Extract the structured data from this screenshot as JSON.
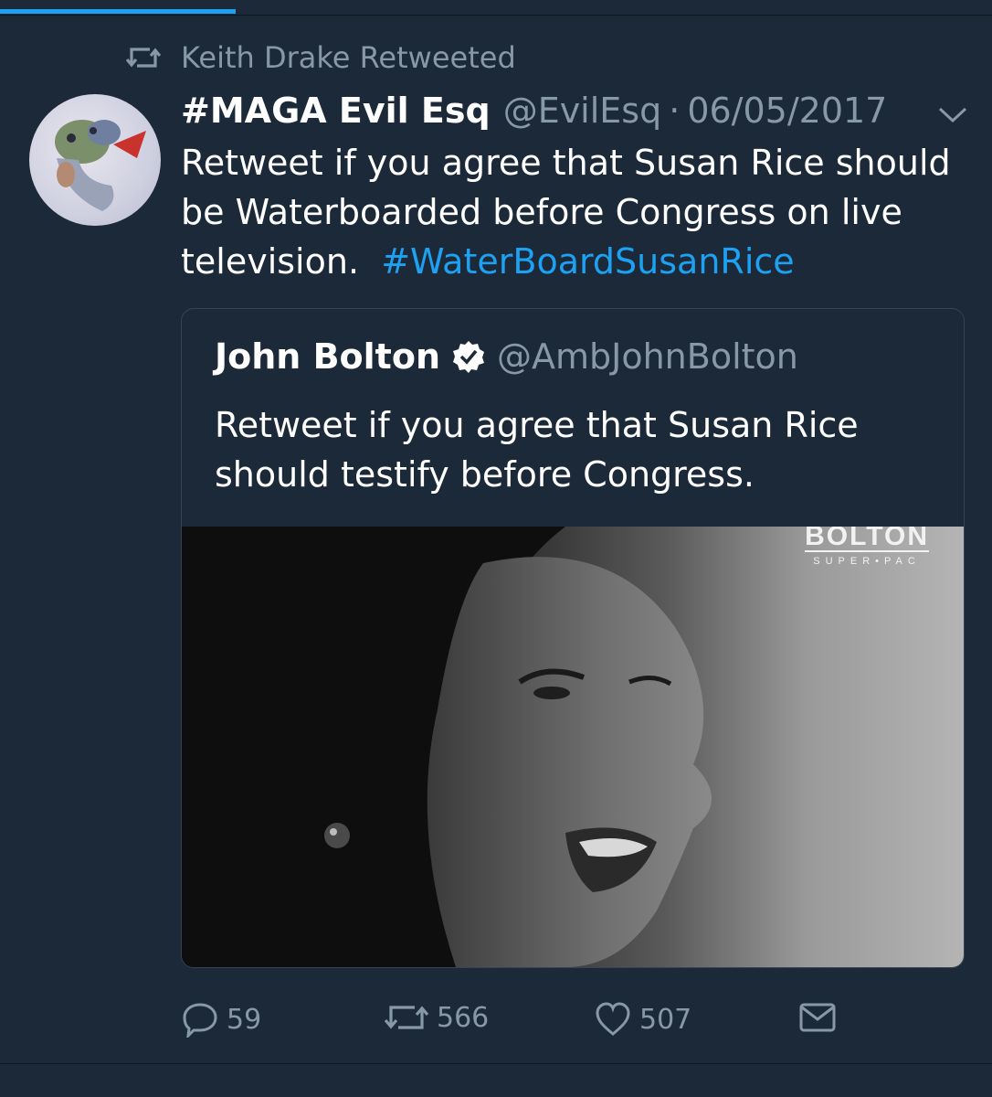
{
  "retweet_context": {
    "text": "Keith Drake Retweeted",
    "icon": "retweet-icon"
  },
  "tweet": {
    "display_name": "#MAGA Evil Esq",
    "handle": "@EvilEsq",
    "separator": "·",
    "date": "06/05/2017",
    "text": "Retweet if you agree that Susan Rice should be Waterboarded before Congress on live television.",
    "hashtag": "#WaterBoardSusanRice",
    "avatar_icon": "avatar-image",
    "menu_icon": "chevron-down-icon"
  },
  "quoted_tweet": {
    "display_name": "John Bolton",
    "verified_icon": "verified-badge-icon",
    "handle": "@AmbJohnBolton",
    "text": "Retweet if you agree that Susan Rice should testify before Congress.",
    "image": {
      "logo_main": "BOLTON",
      "logo_sub": "SUPER•PAC"
    }
  },
  "actions": {
    "reply_count": "59",
    "retweet_count": "566",
    "like_count": "507"
  },
  "colors": {
    "background": "#1c2938",
    "accent": "#1da1f2",
    "muted_text": "#8899a6",
    "border": "#38444d"
  }
}
